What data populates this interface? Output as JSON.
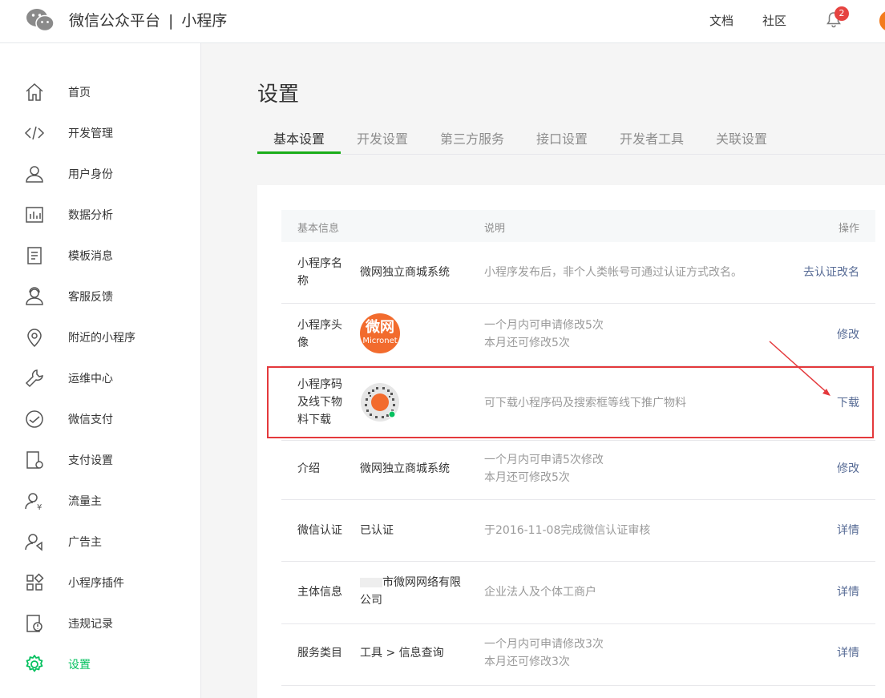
{
  "header": {
    "brand": "微信公众平台",
    "separator": "|",
    "product": "小程序",
    "links": [
      "文档",
      "社区"
    ],
    "notification_count": "2"
  },
  "sidebar": {
    "items": [
      {
        "label": "首页",
        "icon": "home-icon"
      },
      {
        "label": "开发管理",
        "icon": "code-icon"
      },
      {
        "label": "用户身份",
        "icon": "user-icon"
      },
      {
        "label": "数据分析",
        "icon": "chart-icon"
      },
      {
        "label": "模板消息",
        "icon": "document-icon"
      },
      {
        "label": "客服反馈",
        "icon": "service-icon"
      },
      {
        "label": "附近的小程序",
        "icon": "location-icon"
      },
      {
        "label": "运维中心",
        "icon": "wrench-icon"
      },
      {
        "label": "微信支付",
        "icon": "pay-icon"
      },
      {
        "label": "支付设置",
        "icon": "pay-settings-icon"
      },
      {
        "label": "流量主",
        "icon": "traffic-owner-icon"
      },
      {
        "label": "广告主",
        "icon": "advertiser-icon"
      },
      {
        "label": "小程序插件",
        "icon": "plugin-icon"
      },
      {
        "label": "违规记录",
        "icon": "violation-icon"
      },
      {
        "label": "设置",
        "icon": "gear-icon",
        "active": true
      }
    ],
    "active_color": "#07c160"
  },
  "main": {
    "title": "设置",
    "tabs": [
      "基本设置",
      "开发设置",
      "第三方服务",
      "接口设置",
      "开发者工具",
      "关联设置"
    ],
    "table": {
      "headers": {
        "info": "基本信息",
        "desc": "说明",
        "op": "操作"
      },
      "rows": [
        {
          "name": "小程序名称",
          "value": "微网独立商城系统",
          "desc": [
            "小程序发布后，非个人类帐号可通过认证方式改名。"
          ],
          "op": "去认证改名"
        },
        {
          "name": "小程序头像",
          "avatar_text": "微网",
          "avatar_sub": "Micronet",
          "desc": [
            "一个月内可申请修改5次",
            "本月还可修改5次"
          ],
          "op": "修改"
        },
        {
          "name": "小程序码及线下物料下载",
          "desc": [
            "可下载小程序码及搜索框等线下推广物料"
          ],
          "op": "下载"
        },
        {
          "name": "介绍",
          "value": "微网独立商城系统",
          "desc": [
            "一个月内可申请5次修改",
            "本月还可修改5次"
          ],
          "op": "修改"
        },
        {
          "name": "微信认证",
          "value": "已认证",
          "desc": [
            "于2016-11-08完成微信认证审核"
          ],
          "op": "详情"
        },
        {
          "name": "主体信息",
          "value": "市微网网络有限公司",
          "desc": [
            "企业法人及个体工商户"
          ],
          "op": "详情"
        },
        {
          "name": "服务类目",
          "value": "工具 > 信息查询",
          "desc": [
            "一个月内可申请修改3次",
            "本月还可修改3次"
          ],
          "op": "详情"
        }
      ]
    }
  },
  "colors": {
    "link": "#576b95",
    "tab_underline": "#1aad19",
    "highlight": "#e4393c",
    "avatar": "#f26b2d"
  }
}
